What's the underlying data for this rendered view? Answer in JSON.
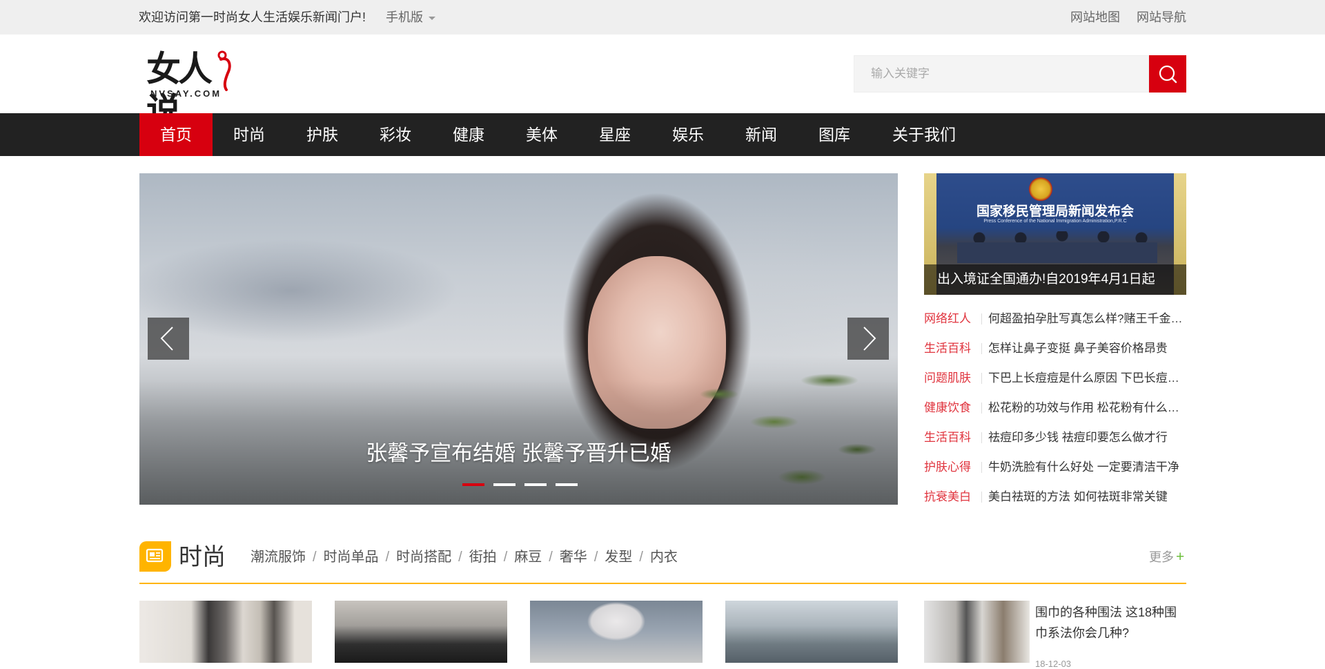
{
  "topbar": {
    "welcome": "欢迎访问第一时尚女人生活娱乐新闻门户!",
    "mobile": "手机版",
    "sitemap": "网站地图",
    "sitenav": "网站导航"
  },
  "logo": {
    "mark": "女人说",
    "domain": "NVSAY.COM"
  },
  "search": {
    "placeholder": "输入关键字",
    "icon": "search-icon"
  },
  "nav": {
    "items": [
      "首页",
      "时尚",
      "护肤",
      "彩妆",
      "健康",
      "美体",
      "星座",
      "娱乐",
      "新闻",
      "图库",
      "关于我们"
    ],
    "active_index": 0
  },
  "slider": {
    "caption": "张馨予宣布结婚 张馨予晋升已婚",
    "slides_total": 4,
    "active_slide": 1,
    "prev_icon": "chevron-left-icon",
    "next_icon": "chevron-right-icon"
  },
  "side_feature": {
    "banner": "国家移民管理局新闻发布会",
    "banner_sub": "Press Conference of the National Immigration Administration,P.R.C",
    "caption": "出入境证全国通办!自2019年4月1日起"
  },
  "side_list": [
    {
      "tag": "网络红人",
      "title": "何超盈拍孕肚写真怎么样?赌王千金何超盈"
    },
    {
      "tag": "生活百科",
      "title": "怎样让鼻子变挺 鼻子美容价格昂贵"
    },
    {
      "tag": "问题肌肤",
      "title": "下巴上长痘痘是什么原因 下巴长痘痘怎么办"
    },
    {
      "tag": "健康饮食",
      "title": "松花粉的功效与作用 松花粉有什么好处"
    },
    {
      "tag": "生活百科",
      "title": "祛痘印多少钱 祛痘印要怎么做才行"
    },
    {
      "tag": "护肤心得",
      "title": "牛奶洗脸有什么好处 一定要清洁干净"
    },
    {
      "tag": "抗衰美白",
      "title": "美白祛斑的方法 如何祛斑非常关键"
    }
  ],
  "section": {
    "icon": "newspaper-icon",
    "title": "时尚",
    "tabs": [
      "潮流服饰",
      "时尚单品",
      "时尚搭配",
      "街拍",
      "麻豆",
      "奢华",
      "发型",
      "内衣"
    ],
    "more": "更多",
    "more_icon": "plus-icon",
    "accent": "#ffb400"
  },
  "side_item": {
    "title": "围巾的各种围法 这18种围巾系法你会几种?",
    "date": "18-12-03"
  },
  "colors": {
    "brand_red": "#d7000f",
    "nav_bg": "#222222",
    "topbar_bg": "#efefef",
    "tag_red": "#e0333d"
  }
}
